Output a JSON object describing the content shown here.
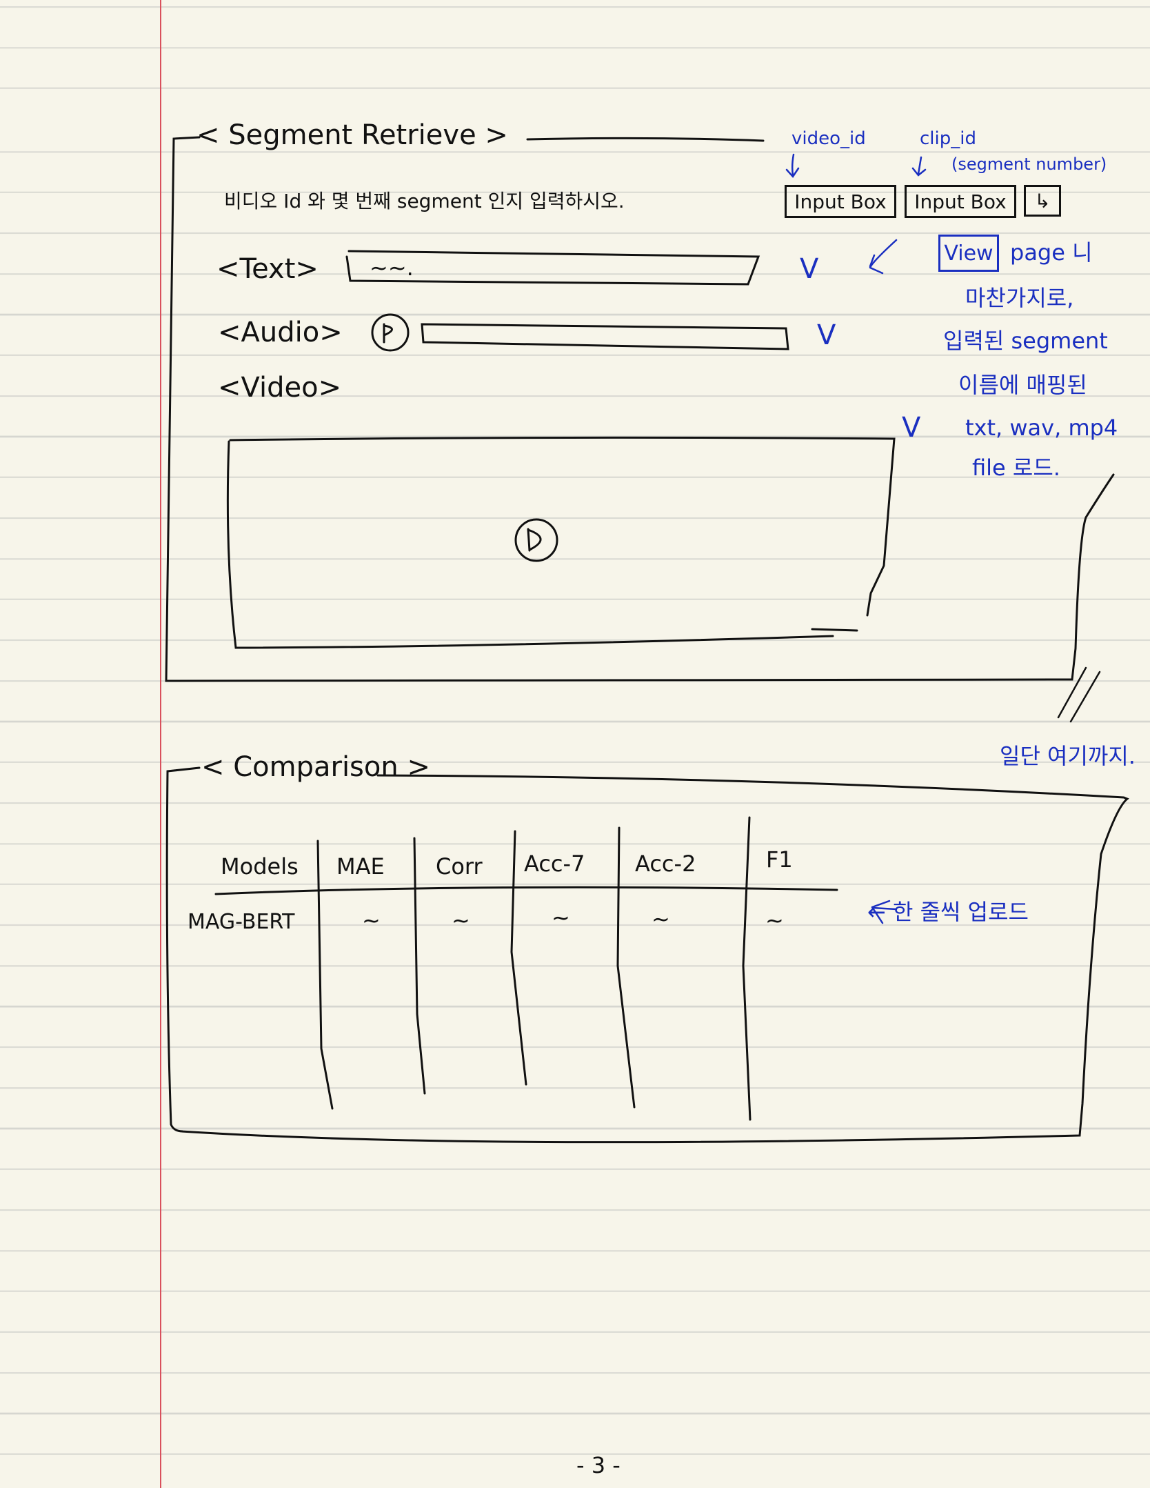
{
  "segment_retrieve": {
    "title": "< Segment Retrieve >",
    "instruction": "비디오 Id 와 몇 번째 segment 인지 입력하시오.",
    "video_id_label": "video_id",
    "clip_id_label": "clip_id",
    "clip_id_note": "(segment number)",
    "video_id_input": "Input Box",
    "clip_id_input": "Input Box",
    "enter_button": "↳",
    "text_label": "<Text>",
    "text_value": "~~.",
    "audio_label": "<Audio>",
    "video_label": "<Video>",
    "checkmark": "V"
  },
  "annotation_view": {
    "view_box": "View",
    "lines": [
      "page 니",
      "마찬가지로,",
      "입력된 segment",
      "이름에 매핑된",
      "txt, wav, mp4",
      "file 로드."
    ]
  },
  "comparison": {
    "title": "< Comparison >",
    "columns": [
      "Models",
      "MAE",
      "Corr",
      "Acc-7",
      "Acc-2",
      "F1"
    ],
    "rows": [
      [
        "MAG-BERT",
        "~",
        "~",
        "~",
        "~",
        "~"
      ]
    ],
    "row_note": "← 한 줄씩 업로드"
  },
  "stop_note": "일단 여기까지.",
  "page_number": "- 3 -",
  "colors": {
    "ink": "#111111",
    "annotation": "#1a2fc0",
    "margin": "#d9505c",
    "paper": "#f7f5ea"
  }
}
